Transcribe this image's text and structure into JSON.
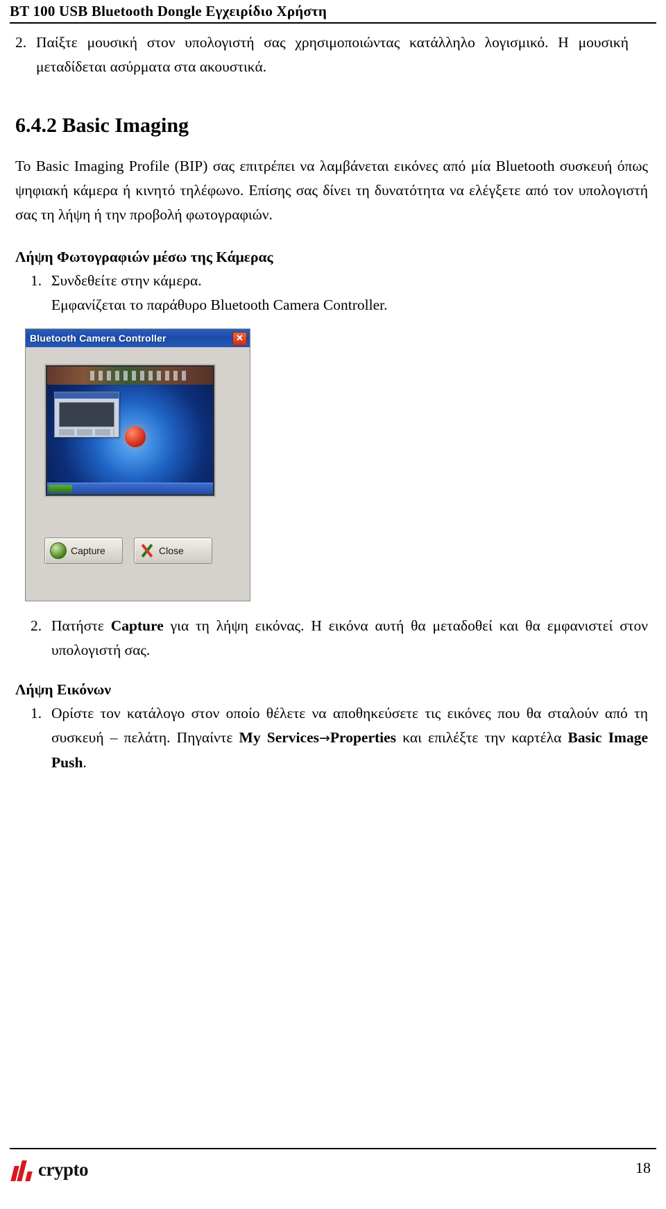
{
  "header": {
    "title": "BT 100 USB Bluetooth Dongle Εγχειρίδιο Χρήστη"
  },
  "content": {
    "item2": {
      "num": "2.",
      "text": "Παίξτε μουσική στον υπολογιστή σας χρησιμοποιώντας κατάλληλο λογισμικό. Η μουσική μεταδίδεται ασύρματα στα ακουστικά."
    },
    "section_heading": "6.4.2 Basic Imaging",
    "intro_paragraph": "To Basic Imaging Profile (BIP) σας επιτρέπει να λαμβάνεται εικόνες από μία Bluetooth συσκευή όπως ψηφιακή κάμερα ή κινητό τηλέφωνο. Επίσης σας δίνει τη δυνατότητα να ελέγξετε από τον υπολογιστή σας τη λήψη ή την προβολή φωτογραφιών.",
    "subhead_camera": "Λήψη Φωτογραφιών μέσω της Κάμερας",
    "camera_step1_num": "1.",
    "camera_step1_text": "Συνδεθείτε στην κάμερα.",
    "camera_step1_sub": "Εμφανίζεται το παράθυρο Bluetooth Camera Controller.",
    "camera_step2_num": "2.",
    "camera_step2_a": "Πατήστε ",
    "camera_step2_bold": "Capture",
    "camera_step2_b": " για τη λήψη εικόνας. Η εικόνα αυτή θα μεταδοθεί και θα εμφανιστεί στον υπολογιστή σας.",
    "subhead_images": "Λήψη Εικόνων",
    "images_step1_num": "1.",
    "images_step1_a": "Ορίστε τον κατάλογο στον οποίο θέλετε να αποθηκεύσετε τις εικόνες που θα σταλούν από τη συσκευή – πελάτη. Πηγαίντε ",
    "images_step1_bold1": "My Services",
    "images_step1_arrow": "→",
    "images_step1_bold2": "Properties",
    "images_step1_b": " και επιλέξτε την καρτέλα ",
    "images_step1_bold3": "Basic Image Push",
    "images_step1_c": "."
  },
  "figure": {
    "window_title": "Bluetooth Camera Controller",
    "close_icon_label": "✕",
    "capture_button": "Capture",
    "close_button": "Close"
  },
  "footer": {
    "logo_text": "crypto",
    "page_number": "18"
  }
}
